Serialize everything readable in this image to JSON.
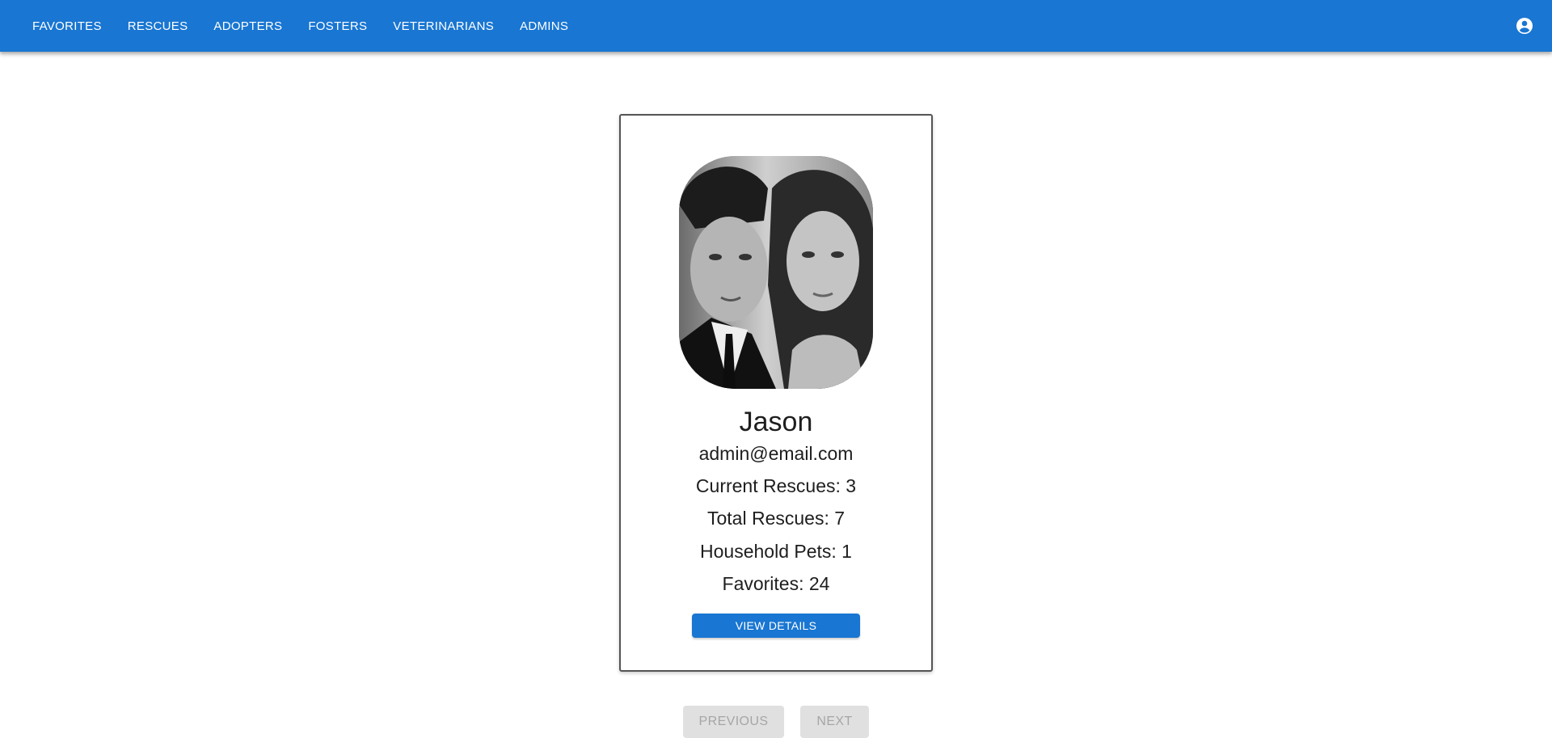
{
  "nav": {
    "items": [
      {
        "label": "FAVORITES"
      },
      {
        "label": "RESCUES"
      },
      {
        "label": "ADOPTERS"
      },
      {
        "label": "FOSTERS"
      },
      {
        "label": "VETERINARIANS"
      },
      {
        "label": "ADMINS"
      }
    ],
    "account_icon": "account-circle-icon"
  },
  "profile": {
    "name": "Jason",
    "email": "admin@email.com",
    "stats": [
      {
        "text": "Current Rescues: 3"
      },
      {
        "text": "Total Rescues: 7"
      },
      {
        "text": "Household Pets: 1"
      },
      {
        "text": "Favorites: 24"
      }
    ],
    "view_details_label": "VIEW DETAILS"
  },
  "pagination": {
    "previous_label": "PREVIOUS",
    "next_label": "NEXT"
  },
  "colors": {
    "primary": "#1976d2",
    "disabled_bg": "#e0e0e0",
    "disabled_text": "#a6a6a6"
  }
}
